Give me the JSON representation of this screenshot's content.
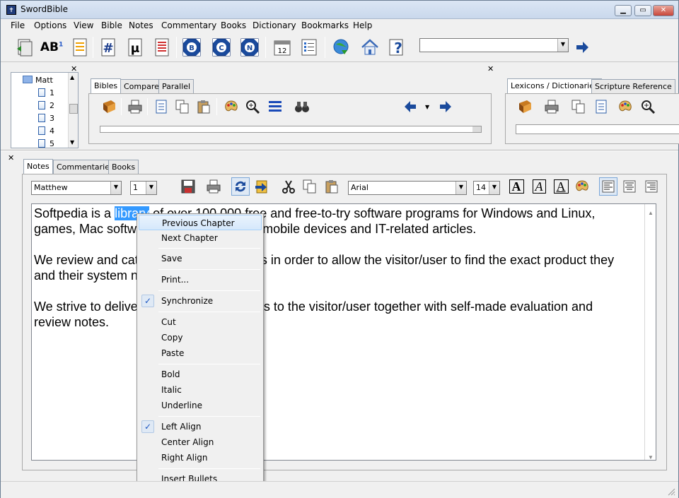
{
  "window": {
    "title": "SwordBible",
    "app_icon_glyph": "✝"
  },
  "menu": [
    "File",
    "Options",
    "View",
    "Bible",
    "Notes",
    "Commentary",
    "Books",
    "Dictionary",
    "Bookmarks",
    "Help"
  ],
  "toolbar": {
    "ab_label": "AB",
    "ab_sup": "1",
    "hash_label": "#",
    "mu_label": "µ",
    "b_label": "B",
    "c_label": "C",
    "n_label": "N",
    "calendar_label": "12",
    "question_label": "?",
    "search_value": ""
  },
  "tree": {
    "root": "Matt",
    "chapters": [
      "1",
      "2",
      "3",
      "4",
      "5"
    ]
  },
  "bibles_panel": {
    "tabs": [
      "Bibles",
      "Compare",
      "Parallel"
    ]
  },
  "lexicons_panel": {
    "tabs": [
      "Lexicons / Dictionaries",
      "Scripture Reference"
    ]
  },
  "notes_panel": {
    "tabs": [
      "Notes",
      "Commentaries",
      "Books"
    ],
    "book_value": "Matthew",
    "chapter_value": "1",
    "font_value": "Arial",
    "size_value": "14",
    "bold_glyph": "A",
    "italic_glyph": "A",
    "underline_glyph": "A"
  },
  "editor": {
    "p1_a": "Softpedia is a ",
    "p1_sel": "library",
    "p1_b": " of over 100,000 free and free-to-try software programs for Windows and Linux,",
    "p1_c": "games, Mac software, Windows drivers, mobile devices and IT-related articles.",
    "p2_a": "We review and categorize these products in order to allow the visitor/user to find the exact product they",
    "p2_b": "and their system needs.",
    "p3_a": "We strive to deliver only the best products to the visitor/user together with self-made evaluation and",
    "p3_b": "review notes."
  },
  "context_menu": {
    "previous_chapter": "Previous Chapter",
    "next_chapter": "Next Chapter",
    "save": "Save",
    "print": "Print...",
    "synchronize": "Synchronize",
    "cut": "Cut",
    "copy": "Copy",
    "paste": "Paste",
    "bold": "Bold",
    "italic": "Italic",
    "underline": "Underline",
    "left_align": "Left Align",
    "center_align": "Center Align",
    "right_align": "Right Align",
    "insert_bullets": "Insert Bullets",
    "check_glyph": "✓"
  },
  "colors": {
    "selection": "#3399ff",
    "title_bar": "#dbe6f4",
    "menu_highlight": "#d6e8fb"
  }
}
